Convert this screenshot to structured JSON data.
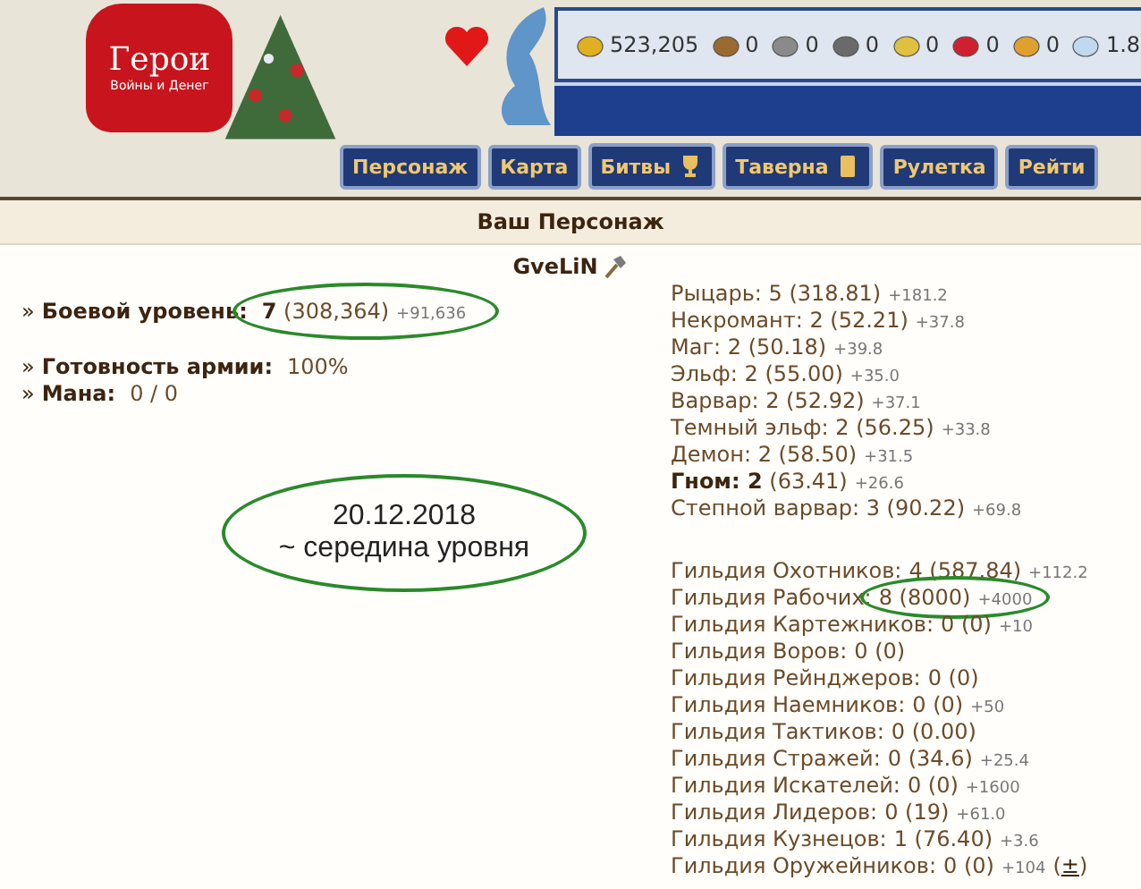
{
  "logo": {
    "title": "Герои",
    "subtitle": "Войны и Денег"
  },
  "resources": [
    {
      "kind": "gold",
      "value": "523,205"
    },
    {
      "kind": "wood",
      "value": "0"
    },
    {
      "kind": "ore",
      "value": "0"
    },
    {
      "kind": "mercury",
      "value": "0"
    },
    {
      "kind": "sulfur",
      "value": "0"
    },
    {
      "kind": "crystal",
      "value": "0"
    },
    {
      "kind": "gems",
      "value": "0"
    },
    {
      "kind": "diamond",
      "value": "1.8"
    }
  ],
  "nav": [
    {
      "label": "Персонаж",
      "kind": "plain"
    },
    {
      "label": "Карта",
      "kind": "plain"
    },
    {
      "label": "Битвы",
      "kind": "trophy"
    },
    {
      "label": "Таверна",
      "kind": "card"
    },
    {
      "label": "Рулетка",
      "kind": "plain"
    },
    {
      "label": "Рейти",
      "kind": "plain"
    }
  ],
  "section_title": "Ваш Персонаж",
  "player": {
    "name": "GveLiN"
  },
  "stats": [
    {
      "bullet": "»",
      "label": "Боевой уровень:",
      "value": "**7** (308,364)",
      "bonus": "+91,636",
      "circled": true,
      "gap_before": false
    },
    {
      "bullet": "»",
      "label": "Готовность армии:",
      "value": "100%",
      "circled": false,
      "gap_before": true
    },
    {
      "bullet": "»",
      "label": "Мана:",
      "value": "0 / 0",
      "circled": false,
      "gap_before": false
    }
  ],
  "factions": [
    {
      "text": "Рыцарь: 5 (318.81)",
      "bonus": "+181.2"
    },
    {
      "text": "Некромант: 2 (52.21)",
      "bonus": "+37.8"
    },
    {
      "text": "Маг: 2 (50.18)",
      "bonus": "+39.8"
    },
    {
      "text": "Эльф: 2 (55.00)",
      "bonus": "+35.0"
    },
    {
      "text": "Варвар: 2 (52.92)",
      "bonus": "+37.1"
    },
    {
      "text": "Темный эльф: 2 (56.25)",
      "bonus": "+33.8"
    },
    {
      "text": "Демон: 2 (58.50)",
      "bonus": "+31.5"
    },
    {
      "text": "**Гном: 2** (63.41)",
      "bonus": "+26.6"
    },
    {
      "text": "Степной варвар: 3 (90.22)",
      "bonus": "+69.8"
    }
  ],
  "guilds": [
    {
      "name": "Гильдия Охотников:",
      "value": "4 (587.84)",
      "bonus": "+112.2",
      "circled": false
    },
    {
      "name": "Гильдия Рабочих:",
      "value": "8 (8000)",
      "bonus": "+4000",
      "circled": true
    },
    {
      "name": "Гильдия Картежников:",
      "value": "0 (0)",
      "bonus": "+10",
      "circled": false
    },
    {
      "name": "Гильдия Воров:",
      "value": "0 (0)",
      "circled": false
    },
    {
      "name": "Гильдия Рейнджеров:",
      "value": "0 (0)",
      "circled": false
    },
    {
      "name": "Гильдия Наемников:",
      "value": "0 (0)",
      "bonus": "+50",
      "circled": false
    },
    {
      "name": "Гильдия Тактиков:",
      "value": "0 (0.00)",
      "circled": false
    },
    {
      "name": "Гильдия Стражей:",
      "value": "0 (34.6)",
      "bonus": "+25.4",
      "circled": false
    },
    {
      "name": "Гильдия Искателей:",
      "value": "0 (0)",
      "bonus": "+1600",
      "circled": false
    },
    {
      "name": "Гильдия Лидеров:",
      "value": "0 (19)",
      "bonus": "+61.0",
      "circled": false
    },
    {
      "name": "Гильдия Кузнецов:",
      "value": "1 (76.40)",
      "bonus": "+3.6",
      "circled": false
    },
    {
      "name": "Гильдия Оружейников:",
      "value": "0 (0)",
      "bonus": "+104",
      "link_before": "(",
      "link": "±",
      "link_after": ")",
      "circled": false
    }
  ],
  "annotation": {
    "lines": [
      "20.12.2018",
      "~ середина уровня"
    ]
  }
}
